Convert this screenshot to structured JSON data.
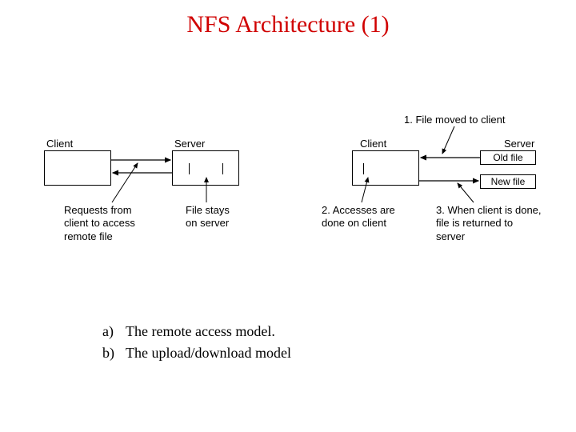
{
  "title": "NFS Architecture (1)",
  "labels": {
    "left_client": "Client",
    "left_server": "Server",
    "right_client": "Client",
    "right_server": "Server",
    "old_file": "Old file",
    "new_file": "New file",
    "file_moved": "1. File moved to client",
    "requests": "Requests from\nclient to access\nremote file",
    "file_stays": "File stays\non server",
    "accesses": "2. Accesses are\ndone on client",
    "returned": "3. When client is done,\nfile is returned to\nserver"
  },
  "footer": {
    "a_marker": "a)",
    "a_text": "The remote access model.",
    "b_marker": "b)",
    "b_text": "The upload/download model"
  }
}
